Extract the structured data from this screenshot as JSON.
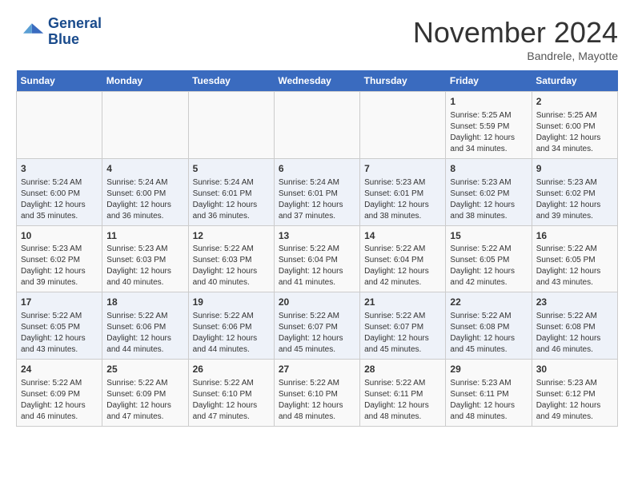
{
  "header": {
    "logo_line1": "General",
    "logo_line2": "Blue",
    "month_title": "November 2024",
    "location": "Bandrele, Mayotte"
  },
  "weekdays": [
    "Sunday",
    "Monday",
    "Tuesday",
    "Wednesday",
    "Thursday",
    "Friday",
    "Saturday"
  ],
  "weeks": [
    [
      {
        "day": "",
        "info": ""
      },
      {
        "day": "",
        "info": ""
      },
      {
        "day": "",
        "info": ""
      },
      {
        "day": "",
        "info": ""
      },
      {
        "day": "",
        "info": ""
      },
      {
        "day": "1",
        "info": "Sunrise: 5:25 AM\nSunset: 5:59 PM\nDaylight: 12 hours and 34 minutes."
      },
      {
        "day": "2",
        "info": "Sunrise: 5:25 AM\nSunset: 6:00 PM\nDaylight: 12 hours and 34 minutes."
      }
    ],
    [
      {
        "day": "3",
        "info": "Sunrise: 5:24 AM\nSunset: 6:00 PM\nDaylight: 12 hours and 35 minutes."
      },
      {
        "day": "4",
        "info": "Sunrise: 5:24 AM\nSunset: 6:00 PM\nDaylight: 12 hours and 36 minutes."
      },
      {
        "day": "5",
        "info": "Sunrise: 5:24 AM\nSunset: 6:01 PM\nDaylight: 12 hours and 36 minutes."
      },
      {
        "day": "6",
        "info": "Sunrise: 5:24 AM\nSunset: 6:01 PM\nDaylight: 12 hours and 37 minutes."
      },
      {
        "day": "7",
        "info": "Sunrise: 5:23 AM\nSunset: 6:01 PM\nDaylight: 12 hours and 38 minutes."
      },
      {
        "day": "8",
        "info": "Sunrise: 5:23 AM\nSunset: 6:02 PM\nDaylight: 12 hours and 38 minutes."
      },
      {
        "day": "9",
        "info": "Sunrise: 5:23 AM\nSunset: 6:02 PM\nDaylight: 12 hours and 39 minutes."
      }
    ],
    [
      {
        "day": "10",
        "info": "Sunrise: 5:23 AM\nSunset: 6:02 PM\nDaylight: 12 hours and 39 minutes."
      },
      {
        "day": "11",
        "info": "Sunrise: 5:23 AM\nSunset: 6:03 PM\nDaylight: 12 hours and 40 minutes."
      },
      {
        "day": "12",
        "info": "Sunrise: 5:22 AM\nSunset: 6:03 PM\nDaylight: 12 hours and 40 minutes."
      },
      {
        "day": "13",
        "info": "Sunrise: 5:22 AM\nSunset: 6:04 PM\nDaylight: 12 hours and 41 minutes."
      },
      {
        "day": "14",
        "info": "Sunrise: 5:22 AM\nSunset: 6:04 PM\nDaylight: 12 hours and 42 minutes."
      },
      {
        "day": "15",
        "info": "Sunrise: 5:22 AM\nSunset: 6:05 PM\nDaylight: 12 hours and 42 minutes."
      },
      {
        "day": "16",
        "info": "Sunrise: 5:22 AM\nSunset: 6:05 PM\nDaylight: 12 hours and 43 minutes."
      }
    ],
    [
      {
        "day": "17",
        "info": "Sunrise: 5:22 AM\nSunset: 6:05 PM\nDaylight: 12 hours and 43 minutes."
      },
      {
        "day": "18",
        "info": "Sunrise: 5:22 AM\nSunset: 6:06 PM\nDaylight: 12 hours and 44 minutes."
      },
      {
        "day": "19",
        "info": "Sunrise: 5:22 AM\nSunset: 6:06 PM\nDaylight: 12 hours and 44 minutes."
      },
      {
        "day": "20",
        "info": "Sunrise: 5:22 AM\nSunset: 6:07 PM\nDaylight: 12 hours and 45 minutes."
      },
      {
        "day": "21",
        "info": "Sunrise: 5:22 AM\nSunset: 6:07 PM\nDaylight: 12 hours and 45 minutes."
      },
      {
        "day": "22",
        "info": "Sunrise: 5:22 AM\nSunset: 6:08 PM\nDaylight: 12 hours and 45 minutes."
      },
      {
        "day": "23",
        "info": "Sunrise: 5:22 AM\nSunset: 6:08 PM\nDaylight: 12 hours and 46 minutes."
      }
    ],
    [
      {
        "day": "24",
        "info": "Sunrise: 5:22 AM\nSunset: 6:09 PM\nDaylight: 12 hours and 46 minutes."
      },
      {
        "day": "25",
        "info": "Sunrise: 5:22 AM\nSunset: 6:09 PM\nDaylight: 12 hours and 47 minutes."
      },
      {
        "day": "26",
        "info": "Sunrise: 5:22 AM\nSunset: 6:10 PM\nDaylight: 12 hours and 47 minutes."
      },
      {
        "day": "27",
        "info": "Sunrise: 5:22 AM\nSunset: 6:10 PM\nDaylight: 12 hours and 48 minutes."
      },
      {
        "day": "28",
        "info": "Sunrise: 5:22 AM\nSunset: 6:11 PM\nDaylight: 12 hours and 48 minutes."
      },
      {
        "day": "29",
        "info": "Sunrise: 5:23 AM\nSunset: 6:11 PM\nDaylight: 12 hours and 48 minutes."
      },
      {
        "day": "30",
        "info": "Sunrise: 5:23 AM\nSunset: 6:12 PM\nDaylight: 12 hours and 49 minutes."
      }
    ]
  ]
}
